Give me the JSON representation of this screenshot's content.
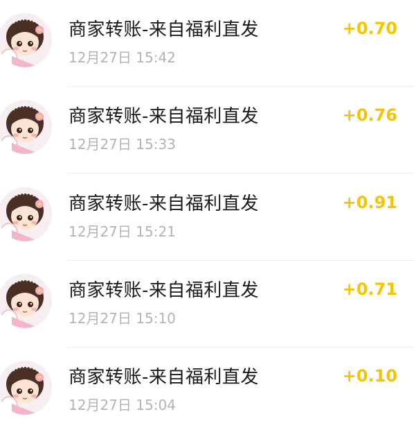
{
  "transactions": [
    {
      "title": "商家转账-来自福利直发",
      "time": "12月27日 15:42",
      "amount": "+0.70"
    },
    {
      "title": "商家转账-来自福利直发",
      "time": "12月27日 15:33",
      "amount": "+0.76"
    },
    {
      "title": "商家转账-来自福利直发",
      "time": "12月27日 15:21",
      "amount": "+0.91"
    },
    {
      "title": "商家转账-来自福利直发",
      "time": "12月27日 15:10",
      "amount": "+0.71"
    },
    {
      "title": "商家转账-来自福利直发",
      "time": "12月27日 15:04",
      "amount": "+0.10"
    }
  ],
  "colors": {
    "amount": "#f5c400",
    "title": "#1a1a1a",
    "time": "#b3b3b3",
    "divider": "#ececec"
  },
  "icons": {
    "avatar": "cartoon-girl-avatar-icon"
  }
}
